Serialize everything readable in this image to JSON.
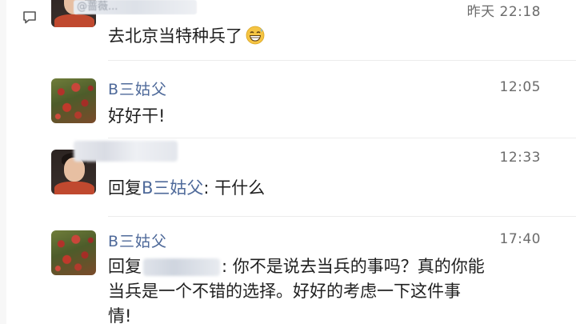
{
  "thread": {
    "top_handle": "@蔷薇...",
    "comments": [
      {
        "user": "",
        "time": "昨天 22:18",
        "text": "去北京当特种兵了",
        "emoji": "grinning-sweat"
      },
      {
        "user": "B三姑父",
        "time": "12:05",
        "text": "好好干!"
      },
      {
        "user": "",
        "time": "12:33",
        "reply_prefix": "回复",
        "reply_to": "B三姑父",
        "reply_body": ": 干什么"
      },
      {
        "user": "B三姑父",
        "time": "17:40",
        "reply_prefix": "回复",
        "line1_rest": ": 你不是说去当兵的事吗？真的你能",
        "line2": "当兵是一个不错的选择。好好的考虑一下这件事",
        "line3": "情!"
      }
    ]
  },
  "icons": {
    "comment": "comment-bubble-icon",
    "emoji": "grinning-sweat-emoji-icon"
  },
  "colors": {
    "username": "#4f6a9a",
    "text": "#1f1f1f",
    "timestamp": "#6b6b6b"
  }
}
